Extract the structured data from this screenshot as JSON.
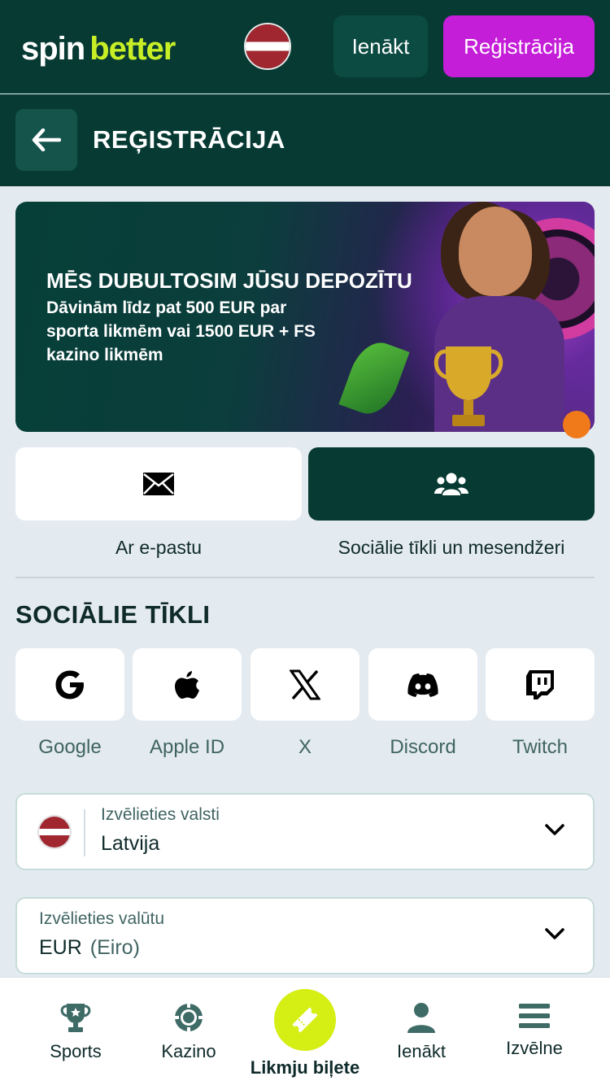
{
  "header": {
    "logo_part1": "spin",
    "logo_part2": "better",
    "login_label": "Ienākt",
    "register_label": "Reģistrācija"
  },
  "subheader": {
    "title": "REĢISTRĀCIJA"
  },
  "banner": {
    "title": "MĒS DUBULTOSIM JŪSU DEPOZĪTU",
    "text": "Dāvinām līdz pat 500 EUR par sporta likmēm vai 1500 EUR + FS kazino likmēm"
  },
  "methods": {
    "email_label": "Ar e-pastu",
    "social_label": "Sociālie tīkli un mesendžeri",
    "email_icon": "envelope-icon",
    "social_icon": "users-icon"
  },
  "social": {
    "title": "SOCIĀLIE TĪKLI",
    "items": [
      {
        "label": "Google",
        "icon": "google-icon"
      },
      {
        "label": "Apple ID",
        "icon": "apple-icon"
      },
      {
        "label": "X",
        "icon": "x-icon"
      },
      {
        "label": "Discord",
        "icon": "discord-icon"
      },
      {
        "label": "Twitch",
        "icon": "twitch-icon"
      }
    ]
  },
  "country": {
    "label": "Izvēlieties valsti",
    "value": "Latvija"
  },
  "currency": {
    "label": "Izvēlieties valūtu",
    "value": "EUR",
    "value_sub": "(Eiro)"
  },
  "bottom_nav": {
    "sports": "Sports",
    "casino": "Kazino",
    "betslip": "Likmju biļete",
    "login": "Ienākt",
    "menu": "Izvēlne"
  },
  "colors": {
    "header_bg": "#063a33",
    "register_btn": "#c51ed8",
    "accent_lime": "#c8ef26",
    "page_bg": "#e3eaf0"
  }
}
